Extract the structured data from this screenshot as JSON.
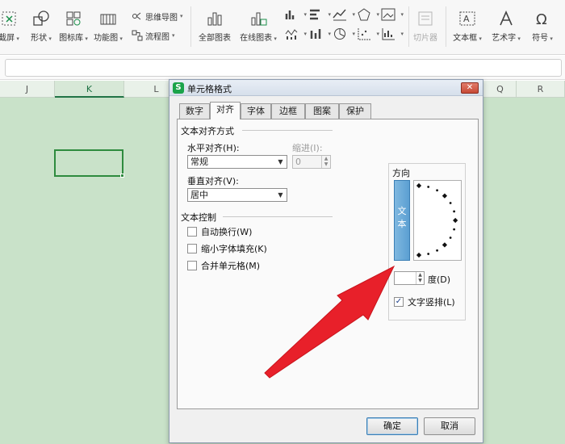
{
  "ribbon": {
    "screenshot_label": "截屏",
    "shapes_label": "形状",
    "icon_library_label": "图标库",
    "function_chart_label": "功能图",
    "mind_map_label": "思维导图",
    "flowchart_label": "流程图",
    "all_charts_label": "全部图表",
    "online_charts_label": "在线图表",
    "slicer_label": "切片器",
    "textbox_label": "文本框",
    "wordart_label": "艺术字",
    "symbol_label": "符号"
  },
  "sheet": {
    "columns": [
      "J",
      "K",
      "L",
      "Q",
      "R"
    ],
    "selected_column": "K"
  },
  "dialog": {
    "logo": "S",
    "title": "单元格格式",
    "close": "✕",
    "tabs": [
      "数字",
      "对齐",
      "字体",
      "边框",
      "图案",
      "保护"
    ],
    "active_tab": "对齐",
    "text_alignment": {
      "group_title": "文本对齐方式",
      "horizontal_label": "水平对齐(H):",
      "horizontal_value": "常规",
      "indent_label": "缩进(I):",
      "indent_value": "0",
      "vertical_label": "垂直对齐(V):",
      "vertical_value": "居中"
    },
    "text_control": {
      "group_title": "文本控制",
      "wrap_text": "自动换行(W)",
      "shrink_to_fit": "缩小字体填充(K)",
      "merge_cells": "合并单元格(M)"
    },
    "orientation": {
      "group_title": "方向",
      "vertical_text_glyph_1": "文",
      "vertical_text_glyph_2": "本",
      "degree_label": "度(D)",
      "vertical_text_checkbox": "文字竖排(L)",
      "vertical_text_checked": true
    },
    "ok_label": "确定",
    "cancel_label": "取消"
  },
  "colors": {
    "sheet_background": "#c9e2c9",
    "selection_border": "#2e8b3e",
    "annotation_arrow": "#e8202a"
  }
}
